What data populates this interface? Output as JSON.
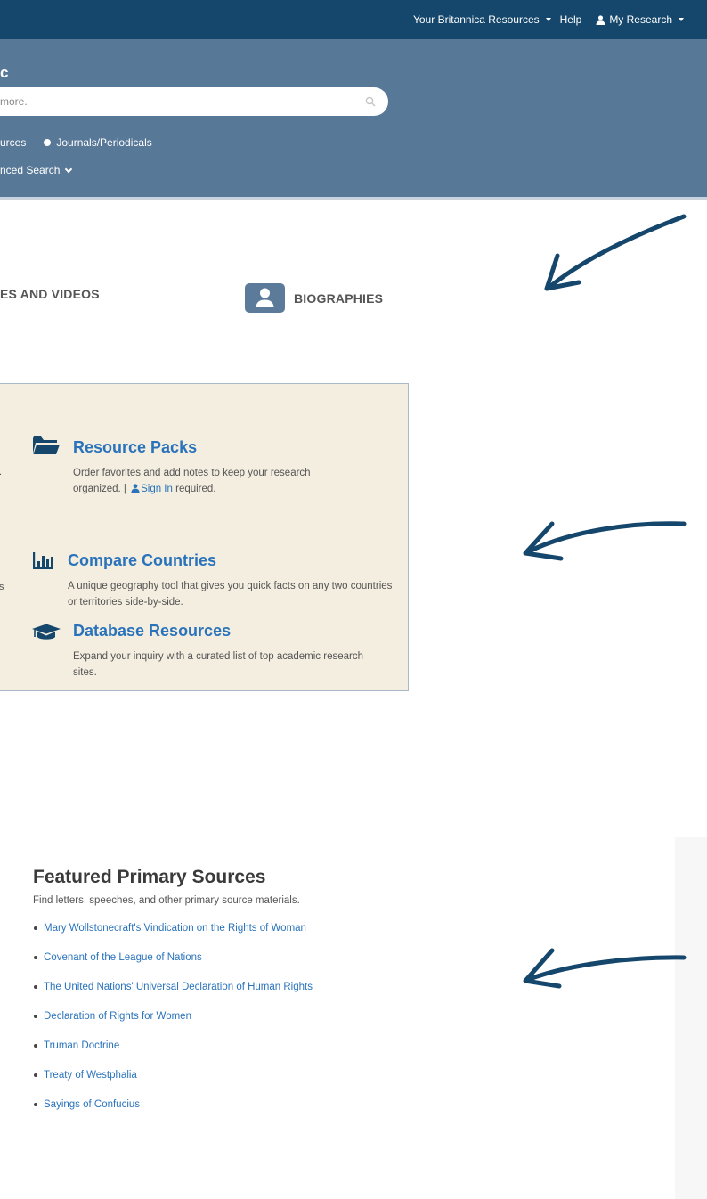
{
  "header": {
    "resources_label": "Your Britannica Resources",
    "help_label": "Help",
    "my_research_label": "My Research"
  },
  "search": {
    "brand_fragment": "c",
    "placeholder": "more.",
    "filter_left_fragment": "urces",
    "filter_journals": "Journals/Periodicals",
    "advanced_fragment": "nced Search"
  },
  "categories": {
    "videos_fragment": "ES AND VIDEOS",
    "biographies": "BIOGRAPHIES"
  },
  "tools": {
    "left_fragments": [
      ".",
      "s"
    ],
    "resource_packs": {
      "title": "Resource Packs",
      "desc_1": "Order favorites and add notes to keep your research",
      "desc_2_prefix": "organized. |",
      "sign_in": "Sign In",
      "desc_2_suffix": "required."
    },
    "compare_countries": {
      "title": "Compare Countries",
      "desc": "A unique geography tool that gives you quick facts on any two countries or territories side-by-side."
    },
    "database_resources": {
      "title": "Database Resources",
      "desc": "Expand your inquiry with a curated list of top academic research sites."
    }
  },
  "featured": {
    "title": "Featured Primary Sources",
    "subtitle": "Find letters, speeches, and other primary source materials.",
    "items": [
      "Mary Wollstonecraft's Vindication on the Rights of Woman",
      "Covenant of the League of Nations",
      "The United Nations' Universal Declaration of Human Rights",
      "Declaration of Rights for Women",
      "Truman Doctrine",
      "Treaty of Westphalia",
      "Sayings of Confucius"
    ]
  },
  "icons": {
    "user": "user-icon",
    "search": "search-icon",
    "folder": "folder-open-icon",
    "chart": "bar-chart-icon",
    "graduation": "graduation-cap-icon",
    "arrow": "arrow-annotation-icon"
  },
  "colors": {
    "topbar": "#15466b",
    "search_band": "#587898",
    "panel_bg": "#f4eee0",
    "link": "#2a73bb",
    "arrow": "#15466b"
  }
}
